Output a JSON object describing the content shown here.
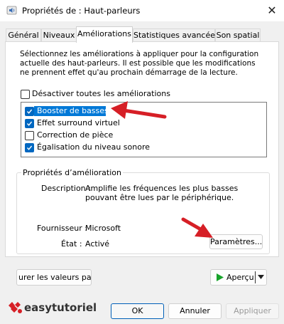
{
  "window": {
    "title": "Propriétés de : Haut-parleurs",
    "close_glyph": "✕"
  },
  "tabs": [
    {
      "label": "Général"
    },
    {
      "label": "Niveaux"
    },
    {
      "label": "Améliorations"
    },
    {
      "label": "Statistiques avancées"
    },
    {
      "label": "Son spatial"
    }
  ],
  "description": "Sélectionnez les améliorations à appliquer pour la configuration actuelle des haut-parleurs. Il est possible que les modifications ne prennent effet qu'au prochain démarrage de la lecture.",
  "disable_all": {
    "label": "Désactiver toutes les améliorations",
    "checked": false
  },
  "enhancements": [
    {
      "label": "Booster de basses",
      "checked": true
    },
    {
      "label": "Effet surround virtuel",
      "checked": true
    },
    {
      "label": "Correction de pièce",
      "checked": false
    },
    {
      "label": "Égalisation du niveau sonore",
      "checked": true
    }
  ],
  "properties": {
    "group_title": "Propriétés d’amélioration",
    "description_label": "Description :",
    "description_value": "Amplifie les fréquences les plus basses pouvant être lues par le périphérique.",
    "provider_label": "Fournisseur :",
    "provider_value": "Microsoft",
    "state_label": "État :",
    "state_value": "Activé",
    "settings_button": "Paramètres..."
  },
  "buttons": {
    "restore_defaults": "urer les valeurs par d",
    "preview": "Aperçu",
    "ok": "OK",
    "cancel": "Annuler",
    "apply": "Appliquer"
  },
  "watermark": {
    "text": "easytutoriel"
  },
  "colors": {
    "accent": "#0067c0",
    "annotation_arrow": "#d61f26",
    "play_green": "#17a32a"
  }
}
